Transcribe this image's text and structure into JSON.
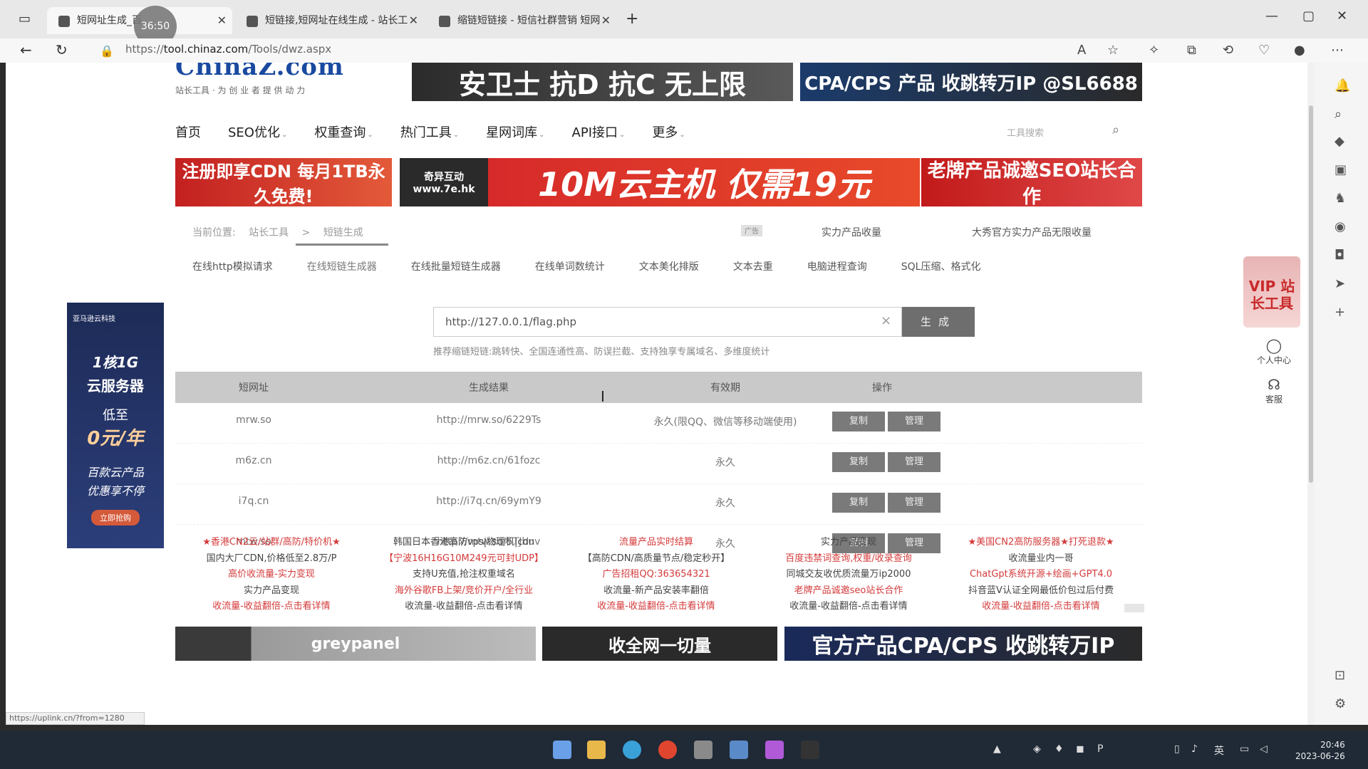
{
  "browser": {
    "tabs": [
      {
        "title": "短网址生成_百",
        "active": true
      },
      {
        "title": "短链接,短网址在线生成 - 站长工",
        "active": false
      },
      {
        "title": "缩链短链接 - 短信社群营销 短网",
        "active": false
      }
    ],
    "timer": "36:50",
    "url_prefix": "https://",
    "url_host": "tool.chinaz.com",
    "url_path": "/Tools/dwz.aspx",
    "status_url": "https://uplink.cn/?from=1280"
  },
  "site": {
    "logo": "ChinaZ.com",
    "logo_sub": "站长工具 · 为 创 业 者 提 供 动 力",
    "nav": [
      "首页",
      "SEO优化",
      "权重查询",
      "热门工具",
      "星网词库",
      "API接口",
      "更多"
    ],
    "nav_has_caret": [
      false,
      true,
      true,
      true,
      true,
      true,
      true
    ],
    "search_placeholder": "工具搜索"
  },
  "banners": {
    "top1": "安卫士 抗D 抗C 无上限",
    "top2": "CPA/CPS 产品 收跳转万IP @SL6688",
    "cdn": "注册即享CDN 每月1TB永久免费!",
    "yun": "10M云主机 仅需19元",
    "yun_brand": "奇异互动 www.7e.hk",
    "seo": "老牌产品诚邀SEO站长合作",
    "grey": "greypanel",
    "xiaoxin": "收全网一切量",
    "cpa": "官方产品CPA/CPS 收跳转万IP"
  },
  "breadcrumb": {
    "label": "当前位置:",
    "items": [
      "站长工具",
      ">",
      "短链生成"
    ],
    "mini_ad": "广告",
    "right1": "实力产品收量",
    "right2": "大秀官方实力产品无限收量"
  },
  "subtabs": [
    "在线http模拟请求",
    "在线短链生成器",
    "在线批量短链生成器",
    "在线单词数统计",
    "文本美化排版",
    "文本去重",
    "电脑进程查询",
    "SQL压缩、格式化"
  ],
  "form": {
    "input_value": "http://127.0.0.1/flag.php",
    "clear": "×",
    "button": "生成",
    "hint": "推荐缩链短链:跳转快、全国连通性高、防误拦截、支持独享专属域名、多维度统计"
  },
  "table": {
    "headers": [
      "短网址",
      "生成结果",
      "有效期",
      "操作"
    ],
    "rows": [
      {
        "domain": "mrw.so",
        "result": "http://mrw.so/6229Ts",
        "validity": "永久(限QQ、微信等移动端使用)"
      },
      {
        "domain": "m6z.cn",
        "result": "http://m6z.cn/61fozc",
        "validity": "永久"
      },
      {
        "domain": "i7q.cn",
        "result": "http://i7q.cn/69ymY9",
        "validity": "永久"
      },
      {
        "domain": "mtw.so",
        "result": "http://mtw.so/5TJbuv",
        "validity": "永久"
      }
    ],
    "copy": "复制",
    "manage": "管理"
  },
  "ads": [
    [
      {
        "t": "★香港CN2云/站群/高防/特价机★",
        "c": "red"
      },
      {
        "t": "国内大厂CDN,价格低至2.8万/P",
        "c": "gray"
      },
      {
        "t": "高价收流量-实力变现",
        "c": "red"
      },
      {
        "t": "实力产品变现",
        "c": "gray"
      },
      {
        "t": "收流量-收益翻倍-点击看详情",
        "c": "red"
      }
    ],
    [
      {
        "t": "韩国日本香港高防vps|物理机|cdn",
        "c": "gray"
      },
      {
        "t": "【宁波16H16G10M249元可封UDP】",
        "c": "red"
      },
      {
        "t": "支持U充值,抢注权重域名",
        "c": "gray"
      },
      {
        "t": "海外谷歌FB上架/竞价开户/全行业",
        "c": "red"
      },
      {
        "t": "收流量-收益翻倍-点击看详情",
        "c": "gray"
      }
    ],
    [
      {
        "t": "流量产品实时结算",
        "c": "red"
      },
      {
        "t": "【高防CDN/高质量节点/稳定秒开】",
        "c": "gray"
      },
      {
        "t": "广告招租QQ:363654321",
        "c": "red"
      },
      {
        "t": "收流量-新产品安装率翻倍",
        "c": "gray"
      },
      {
        "t": "收流量-收益翻倍-点击看详情",
        "c": "red"
      }
    ],
    [
      {
        "t": "实力产品变现",
        "c": "gray"
      },
      {
        "t": "百度违禁词查询,权重/收录查询",
        "c": "red"
      },
      {
        "t": "同城交友收优质流量万ip2000",
        "c": "gray"
      },
      {
        "t": "老牌产品诚邀seo站长合作",
        "c": "red"
      },
      {
        "t": "收流量-收益翻倍-点击看详情",
        "c": "gray"
      }
    ],
    [
      {
        "t": "★美国CN2高防服务器★打死退款★",
        "c": "red"
      },
      {
        "t": "收流量业内一哥",
        "c": "gray"
      },
      {
        "t": "ChatGpt系统开源+绘画+GPT4.0",
        "c": "red"
      },
      {
        "t": "抖音蓝V认证全网最低价包过后付费",
        "c": "gray"
      },
      {
        "t": "收流量-收益翻倍-点击看详情",
        "c": "red"
      }
    ]
  ],
  "side_ad": {
    "brand": "亚马逊云科技",
    "l1": "1核1G",
    "l2": "云服务器",
    "l3": "低至",
    "l4": "0元/年",
    "l5": "百款云产品",
    "l6": "优惠享不停",
    "cta": "立即抢购"
  },
  "vip": {
    "text": "VIP 站长工具",
    "user_center": "个人中心",
    "service": "客服"
  },
  "taskbar": {
    "time": "20:46",
    "date": "2023-06-26",
    "ime": "英"
  }
}
